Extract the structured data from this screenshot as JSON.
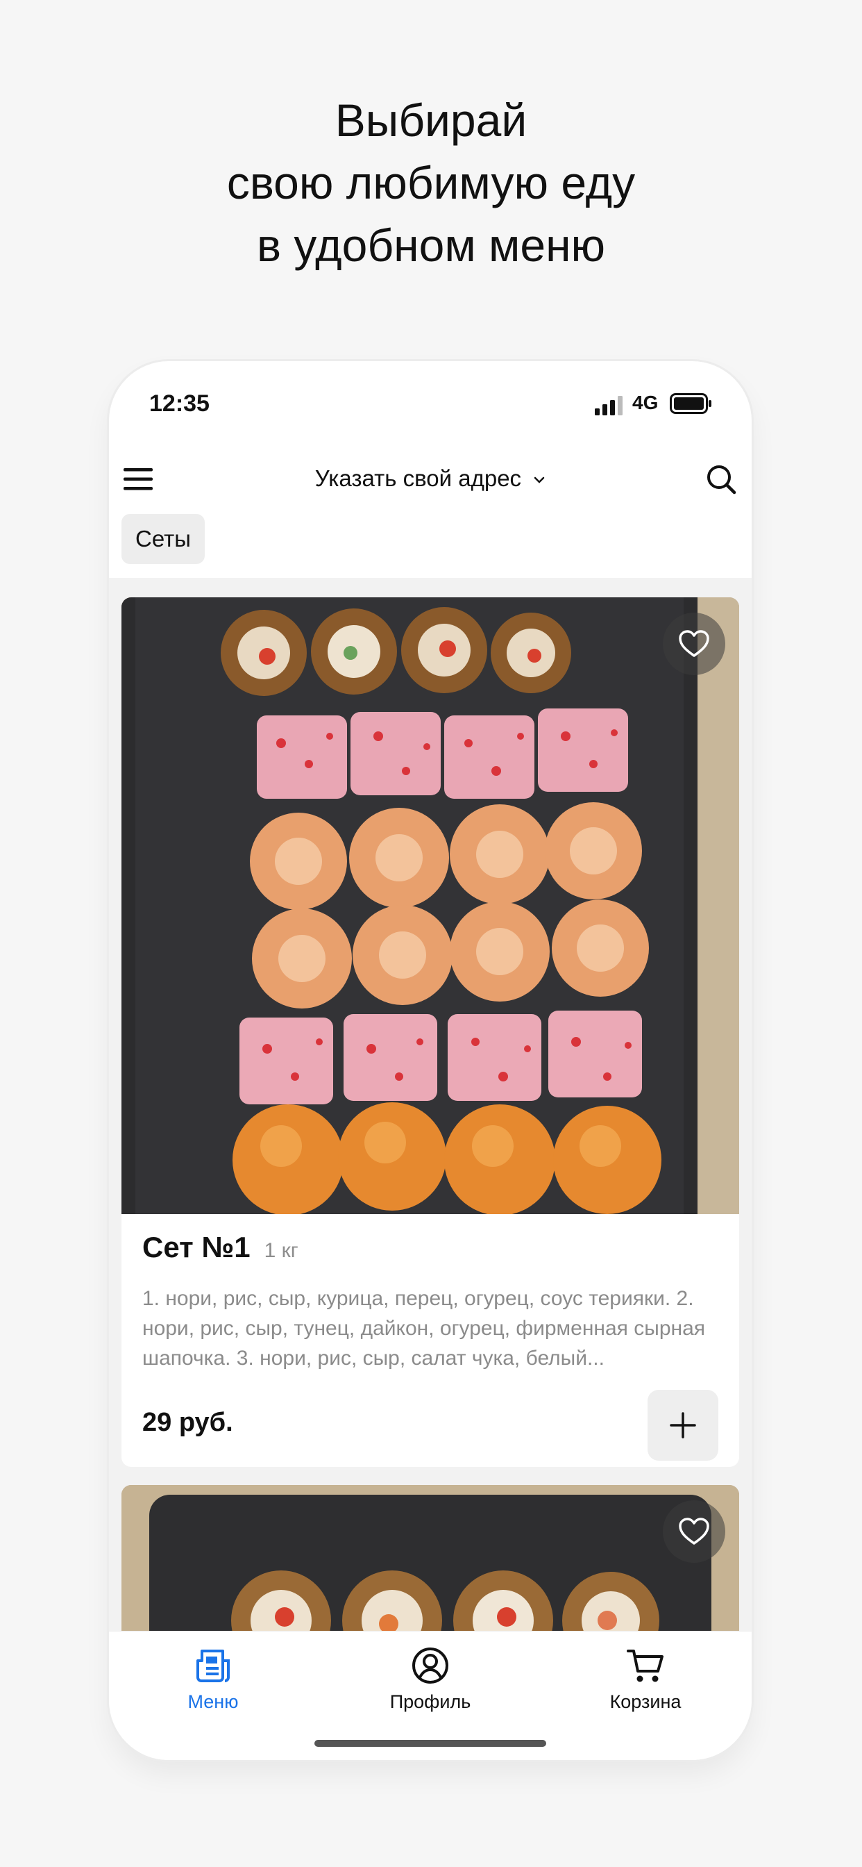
{
  "headline": {
    "line1": "Выбирай",
    "line2": "свою любимую еду",
    "line3": "в удобном меню"
  },
  "status_bar": {
    "time": "12:35",
    "network": "4G",
    "icons": [
      "signal-icon",
      "battery-icon"
    ]
  },
  "app_bar": {
    "address_label": "Указать свой адрес",
    "icons": [
      "hamburger-menu-icon",
      "chevron-down-icon",
      "search-icon"
    ]
  },
  "categories": [
    {
      "label": "Сеты",
      "selected": true
    }
  ],
  "products": [
    {
      "name": "Сет №1",
      "weight": "1 кг",
      "description": "1. нори, рис, сыр, курица, перец, огурец, соус терияки. 2. нори, рис, сыр, тунец, дайкон, огурец, фирменная сырная шапочка. 3. нори, рис, сыр, салат чука, белый...",
      "price": "29 руб.",
      "image": "sushi-set-photo",
      "favorite_icon": "heart-icon",
      "add_icon": "plus-icon"
    },
    {
      "image": "sushi-set-photo",
      "favorite_icon": "heart-icon"
    }
  ],
  "tab_bar": {
    "tabs": [
      {
        "label": "Меню",
        "icon": "menu-document-icon",
        "active": true
      },
      {
        "label": "Профиль",
        "icon": "profile-icon",
        "active": false
      },
      {
        "label": "Корзина",
        "icon": "cart-icon",
        "active": false
      }
    ],
    "active_color": "#1a73e8"
  }
}
